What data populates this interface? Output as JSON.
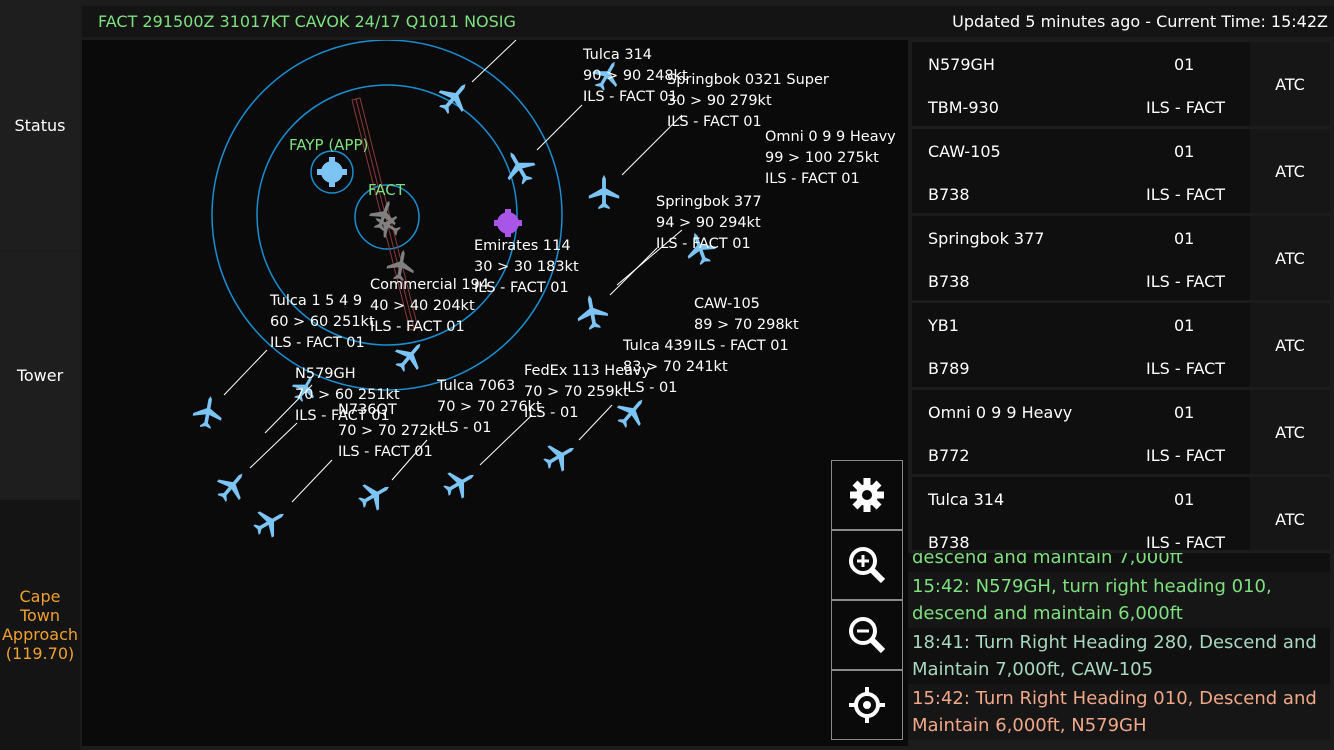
{
  "sidebar": {
    "status": "Status",
    "tower": "Tower",
    "approach": "Cape Town Approach (119.70)"
  },
  "header": {
    "metar": "FACT 291500Z 31017KT CAVOK 24/17 Q1011 NOSIG",
    "updated": "Updated 5 minutes ago - Current Time: 15:42Z"
  },
  "map": {
    "fayp": "FAYP (APP)",
    "fact": "FACT",
    "labels": [
      [
        "Tulca 314",
        "90 > 90 248kt",
        "ILS - FACT 01"
      ],
      [
        "Springbok 0321 Super",
        "30 > 90 279kt",
        "ILS - FACT 01"
      ],
      [
        "Omni 0 9 9 Heavy",
        "99 > 100 275kt",
        "ILS - FACT 01"
      ],
      [
        "Springbok 377",
        "94 > 90 294kt",
        "ILS - FACT 01"
      ],
      [
        "Emirates 114",
        "30 > 30 183kt",
        "ILS - FACT 01"
      ],
      [
        "Commercial 194",
        "40 > 40 204kt",
        "ILS - FACT 01"
      ],
      [
        "Tulca 1 5 4 9",
        "60 > 60 251kt",
        "ILS - FACT 01"
      ],
      [
        "CAW-105",
        "89 > 70 298kt",
        "ILS - FACT 01"
      ],
      [
        "Tulca 439",
        "83 > 70 241kt",
        "ILS -  01"
      ],
      [
        "FedEx 113 Heavy",
        "70 > 70 259kt",
        "ILS -  01"
      ],
      [
        "Tulca 7063",
        "70 > 70 276kt",
        "ILS -  01"
      ],
      [
        "N579GH",
        "70 > 60 251kt",
        "ILS - FACT 01"
      ],
      [
        "N736QT",
        "70 > 70 272kt",
        "ILS - FACT 01"
      ]
    ]
  },
  "tools": {
    "settings": "settings",
    "zoom_in": "zoom-in",
    "zoom_out": "zoom-out",
    "center": "center"
  },
  "strips": [
    {
      "callsign": "N579GH",
      "type": "TBM-930",
      "runway": "01",
      "approach": "ILS - FACT",
      "control": "ATC"
    },
    {
      "callsign": "CAW-105",
      "type": "B738",
      "runway": "01",
      "approach": "ILS - FACT",
      "control": "ATC"
    },
    {
      "callsign": "Springbok 377",
      "type": "B738",
      "runway": "01",
      "approach": "ILS - FACT",
      "control": "ATC"
    },
    {
      "callsign": "YB1",
      "type": "B789",
      "runway": "01",
      "approach": "ILS - FACT",
      "control": "ATC"
    },
    {
      "callsign": "Omni 0 9 9 Heavy",
      "type": "B772",
      "runway": "01",
      "approach": "ILS - FACT",
      "control": "ATC"
    },
    {
      "callsign": "Tulca 314",
      "type": "B738",
      "runway": "01",
      "approach": "ILS - FACT",
      "control": "ATC"
    }
  ],
  "log": [
    {
      "text": "descend and maintain 7,000ft",
      "color": "#7ee07e"
    },
    {
      "text": "15:42: N579GH, turn right heading 010, descend and maintain 6,000ft",
      "color": "#7ee07e"
    },
    {
      "text": "18:41: Turn Right Heading 280, Descend and Maintain 7,000ft, CAW-105",
      "color": "#a8d8c0"
    },
    {
      "text": "15:42: Turn Right Heading 010, Descend and Maintain 6,000ft, N579GH",
      "color": "#f0a888"
    }
  ],
  "colors": {
    "aircraft": "#7cc4f4",
    "rings": "#1a8fd0",
    "ground": "#808080",
    "marker": "#a855e8",
    "approach_text": "#f0a030"
  }
}
